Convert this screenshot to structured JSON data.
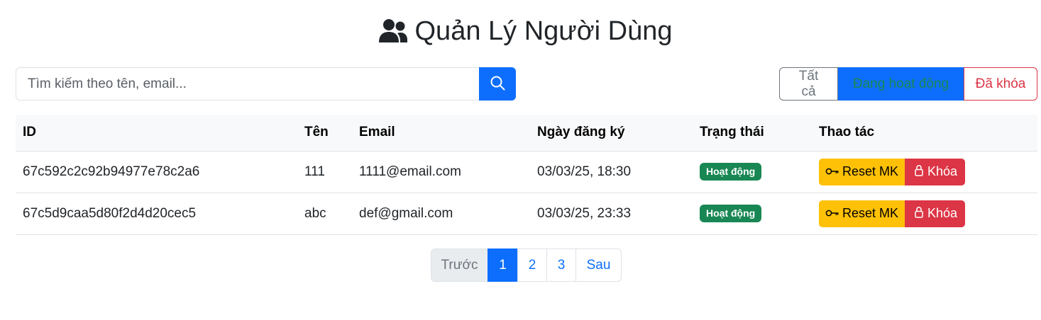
{
  "header": {
    "title": "Quản Lý Người Dùng",
    "icon": "users-icon"
  },
  "search": {
    "placeholder": "Tìm kiếm theo tên, email...",
    "value": "",
    "button_icon": "search-icon"
  },
  "filters": {
    "all": "Tất cả",
    "active": "Đang hoạt động",
    "locked": "Đã khóa",
    "selected": "active"
  },
  "table": {
    "headers": {
      "id": "ID",
      "name": "Tên",
      "email": "Email",
      "date": "Ngày đăng ký",
      "status": "Trạng thái",
      "actions": "Thao tác"
    },
    "rows": [
      {
        "id": "67c592c2c92b94977e78c2a6",
        "name": "111",
        "email": "1111@email.com",
        "date": "03/03/25, 18:30",
        "status": "Hoạt động",
        "reset_label": "Reset MK",
        "lock_label": "Khóa"
      },
      {
        "id": "67c5d9caa5d80f2d4d20cec5",
        "name": "abc",
        "email": "def@gmail.com",
        "date": "03/03/25, 23:33",
        "status": "Hoạt động",
        "reset_label": "Reset MK",
        "lock_label": "Khóa"
      }
    ]
  },
  "pagination": {
    "prev": "Trước",
    "pages": [
      "1",
      "2",
      "3"
    ],
    "next": "Sau",
    "current": "1"
  },
  "colors": {
    "primary": "#0d6efd",
    "success": "#198754",
    "warning": "#ffc107",
    "danger": "#dc3545",
    "secondary": "#6c757d"
  }
}
